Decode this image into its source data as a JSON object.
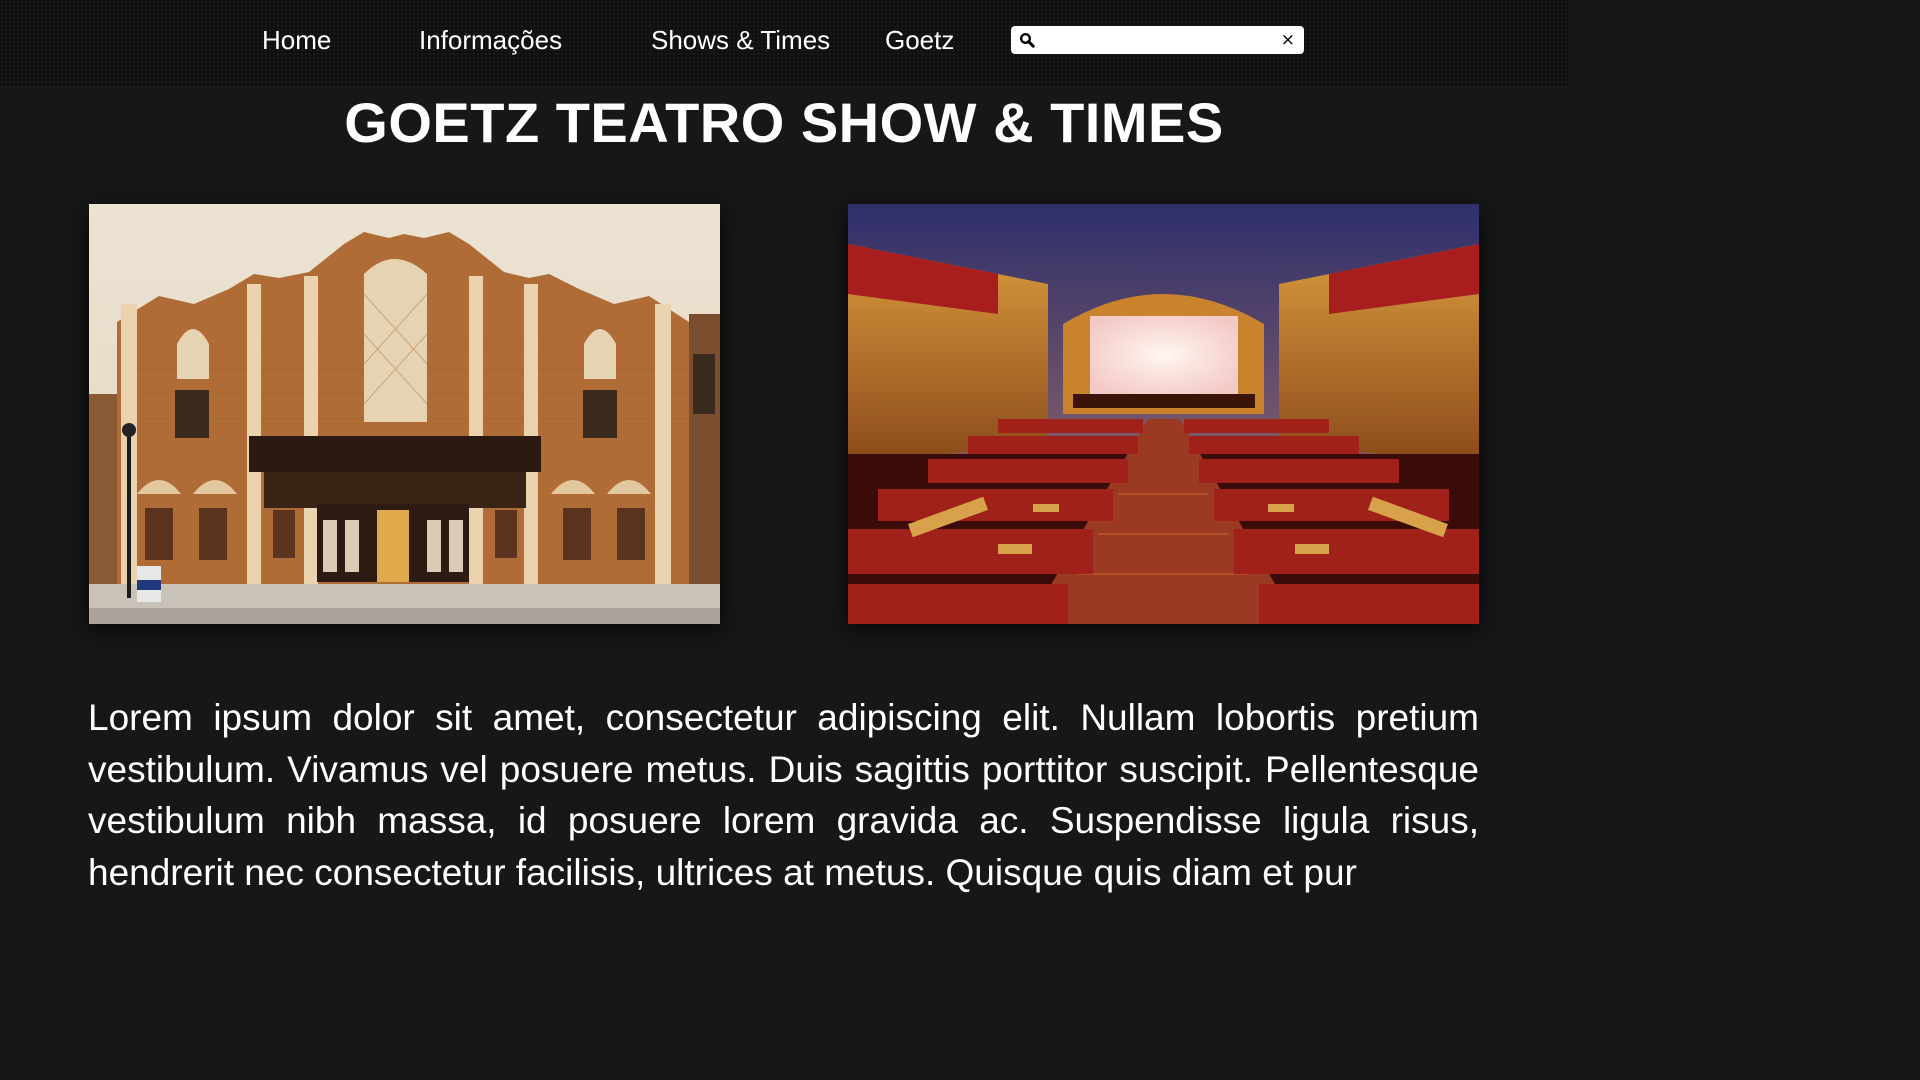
{
  "nav": {
    "items": [
      {
        "label": "Home"
      },
      {
        "label": "Informações"
      },
      {
        "label": "Shows & Times"
      },
      {
        "label": "Goetz"
      }
    ],
    "search": {
      "value": "",
      "placeholder": "",
      "icon": "search-icon",
      "clear_symbol": "×"
    }
  },
  "page": {
    "title": "GOETZ TEATRO SHOW & TIMES"
  },
  "images": [
    {
      "icon": "theater-exterior-photo"
    },
    {
      "icon": "theater-auditorium-photo"
    }
  ],
  "content": {
    "paragraph": "Lorem ipsum dolor sit amet, consectetur adipiscing elit. Nullam lobortis pretium vestibulum. Vivamus vel posuere metus. Duis sagittis porttitor suscipit. Pellentesque vestibulum nibh massa, id posuere lorem gravida ac. Suspendisse ligula risus, hendrerit nec consectetur facilisis, ultrices at metus. Quisque quis diam et pur"
  },
  "colors": {
    "background": "#171717",
    "navbar": "#101010",
    "text": "#ffffff"
  }
}
